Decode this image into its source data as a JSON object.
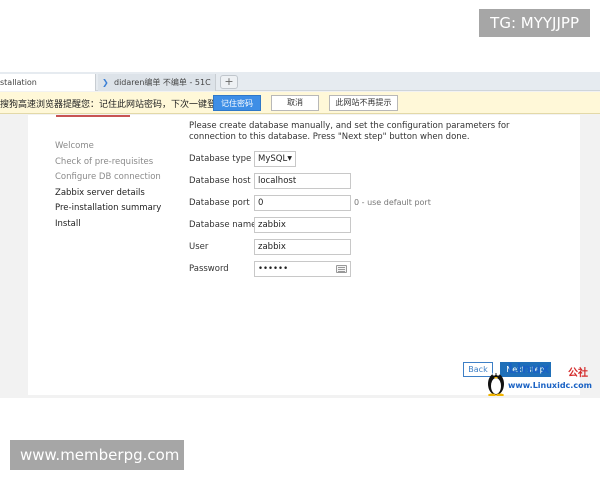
{
  "watermark_top": "TG: MYYJJPP",
  "watermark_bottom": "www.memberpg.com",
  "tabs": [
    {
      "label": "stallation"
    },
    {
      "label": "didaren编单 不编单 - 51C"
    }
  ],
  "new_tab_label": "+",
  "infobar": {
    "message": "搜狗高速浏览器提醒您：记住此网站密码，下次一键登录！",
    "remember_label": "记住密码",
    "cancel_label": "取消",
    "never_label": "此网站不再提示"
  },
  "steps": [
    {
      "label": "Welcome",
      "state": "done"
    },
    {
      "label": "Check of pre-requisites",
      "state": "done"
    },
    {
      "label": "Configure DB connection",
      "state": "current"
    },
    {
      "label": "Zabbix server details",
      "state": "todo"
    },
    {
      "label": "Pre-installation summary",
      "state": "todo"
    },
    {
      "label": "Install",
      "state": "todo"
    }
  ],
  "intro": "Please create database manually, and set the configuration parameters for connection to this database. Press \"Next step\" button when done.",
  "form": {
    "db_type_label": "Database type",
    "db_type_value": "MySQL",
    "db_host_label": "Database host",
    "db_host_value": "localhost",
    "db_port_label": "Database port",
    "db_port_value": "0",
    "db_port_hint": "0 - use default port",
    "db_name_label": "Database name",
    "db_name_value": "zabbix",
    "user_label": "User",
    "user_value": "zabbix",
    "password_label": "Password",
    "password_value": "••••••"
  },
  "buttons": {
    "back_label": "Back",
    "next_label": "Next step"
  },
  "logo": {
    "word": "Linux",
    "cn": "公社",
    "url": "www.Linuxidc.com"
  },
  "colors": {
    "primary_button": "#1f6fb8",
    "remember_button": "#3e8ee6",
    "infobar_bg": "#fff8d8",
    "accent": "#c85454"
  }
}
